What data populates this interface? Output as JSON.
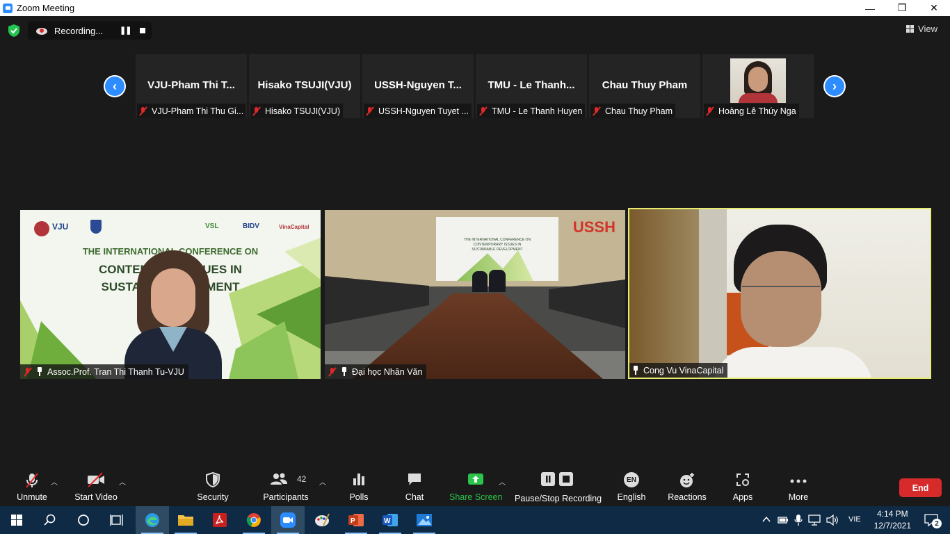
{
  "window": {
    "title": "Zoom Meeting",
    "minimize": "—",
    "maximize": "❐",
    "close": "✕"
  },
  "recording": {
    "label": "Recording...",
    "pause": "❚❚"
  },
  "view_label": "View",
  "thumbnails": [
    {
      "display_name": "VJU-Pham Thi T...",
      "caption": "VJU-Pham Thi Thu Gi...",
      "muted": true
    },
    {
      "display_name": "Hisako TSUJI(VJU)",
      "caption": "Hisako TSUJI(VJU)",
      "muted": true
    },
    {
      "display_name": "USSH-Nguyen T...",
      "caption": "USSH-Nguyen Tuyet ...",
      "muted": true
    },
    {
      "display_name": "TMU - Le Thanh...",
      "caption": "TMU - Le Thanh Huyen",
      "muted": true
    },
    {
      "display_name": "Chau Thuy Pham",
      "caption": "Chau Thuy Pham",
      "muted": true
    },
    {
      "display_name": "",
      "caption": "Hoàng Lê Thúy Nga",
      "muted": true,
      "has_photo": true
    }
  ],
  "nav": {
    "prev": "‹",
    "next": "›"
  },
  "tiles": [
    {
      "caption": "Assoc.Prof. Tran Thi Thanh Tu-VJU",
      "muted": true,
      "pinned": true,
      "logo_text": "VJU",
      "sponsors": [
        "VSL",
        "BIDV",
        "VinaCapital"
      ],
      "banner_lines": [
        "THE INTERNATIONAL CONFERENCE ON",
        "CONTEMPO      SSUES IN",
        "SUSTAINAB      OPMENT"
      ]
    },
    {
      "caption": "Đại học Nhân Văn",
      "muted": true,
      "pinned": true,
      "logo_text": "USSH",
      "board_lines": [
        "THE INTERNATIONAL CONFERENCE ON",
        "CONTEMPORARY ISSUES IN",
        "SUSTAINABLE DEVELOPMENT"
      ]
    },
    {
      "caption": "Cong Vu VinaCapital",
      "muted": false,
      "pinned": true,
      "active_speaker": true
    }
  ],
  "controls": {
    "unmute": "Unmute",
    "start_video": "Start Video",
    "security": "Security",
    "participants": "Participants",
    "participants_count": "42",
    "polls": "Polls",
    "chat": "Chat",
    "share_screen": "Share Screen",
    "pause_stop_recording": "Pause/Stop Recording",
    "english": "English",
    "language_badge": "EN",
    "reactions": "Reactions",
    "apps": "Apps",
    "more": "More",
    "end": "End"
  },
  "colors": {
    "accent_blue": "#2d8cff",
    "end_red": "#d72b2b",
    "share_green": "#2bc34a",
    "speaker_border": "#e6ec6e",
    "muted_red": "#e02828"
  },
  "taskbar": {
    "apps": [
      "start-icon",
      "search-icon",
      "cortana-icon",
      "task-view-icon",
      "edge-icon",
      "file-explorer-icon",
      "acrobat-icon",
      "chrome-icon",
      "zoom-icon",
      "paint-icon",
      "powerpoint-icon",
      "word-icon",
      "photos-icon"
    ],
    "language": "VIE",
    "time": "4:14 PM",
    "date": "12/7/2021",
    "notification_count": "2"
  }
}
